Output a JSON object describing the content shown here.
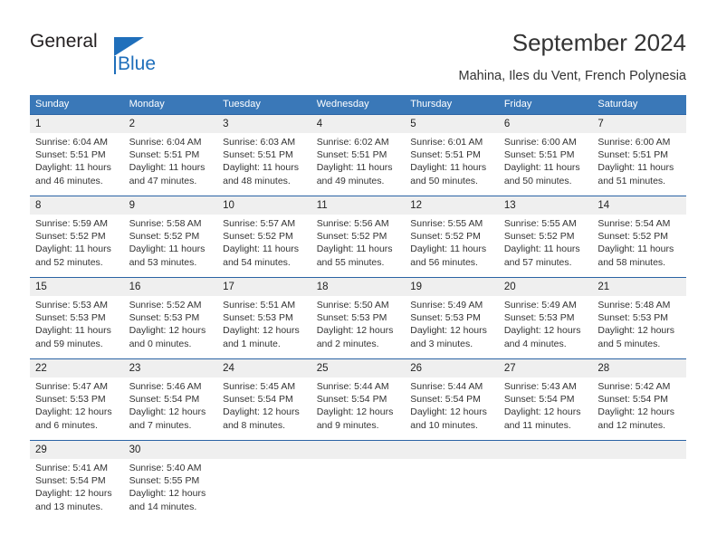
{
  "brand": {
    "name_part1": "General",
    "name_part2": "Blue",
    "accent_color": "#1f6fbb",
    "triangle_icon": "triangle-icon"
  },
  "header": {
    "title": "September 2024",
    "subtitle": "Mahina, Iles du Vent, French Polynesia"
  },
  "calendar": {
    "header_bg": "#3a78b8",
    "daynum_bg": "#efefef",
    "row_divider_color": "#2a63a4",
    "weekdays": [
      "Sunday",
      "Monday",
      "Tuesday",
      "Wednesday",
      "Thursday",
      "Friday",
      "Saturday"
    ],
    "weeks": [
      [
        {
          "day": "1",
          "sunrise": "Sunrise: 6:04 AM",
          "sunset": "Sunset: 5:51 PM",
          "daylight_line1": "Daylight: 11 hours",
          "daylight_line2": "and 46 minutes."
        },
        {
          "day": "2",
          "sunrise": "Sunrise: 6:04 AM",
          "sunset": "Sunset: 5:51 PM",
          "daylight_line1": "Daylight: 11 hours",
          "daylight_line2": "and 47 minutes."
        },
        {
          "day": "3",
          "sunrise": "Sunrise: 6:03 AM",
          "sunset": "Sunset: 5:51 PM",
          "daylight_line1": "Daylight: 11 hours",
          "daylight_line2": "and 48 minutes."
        },
        {
          "day": "4",
          "sunrise": "Sunrise: 6:02 AM",
          "sunset": "Sunset: 5:51 PM",
          "daylight_line1": "Daylight: 11 hours",
          "daylight_line2": "and 49 minutes."
        },
        {
          "day": "5",
          "sunrise": "Sunrise: 6:01 AM",
          "sunset": "Sunset: 5:51 PM",
          "daylight_line1": "Daylight: 11 hours",
          "daylight_line2": "and 50 minutes."
        },
        {
          "day": "6",
          "sunrise": "Sunrise: 6:00 AM",
          "sunset": "Sunset: 5:51 PM",
          "daylight_line1": "Daylight: 11 hours",
          "daylight_line2": "and 50 minutes."
        },
        {
          "day": "7",
          "sunrise": "Sunrise: 6:00 AM",
          "sunset": "Sunset: 5:51 PM",
          "daylight_line1": "Daylight: 11 hours",
          "daylight_line2": "and 51 minutes."
        }
      ],
      [
        {
          "day": "8",
          "sunrise": "Sunrise: 5:59 AM",
          "sunset": "Sunset: 5:52 PM",
          "daylight_line1": "Daylight: 11 hours",
          "daylight_line2": "and 52 minutes."
        },
        {
          "day": "9",
          "sunrise": "Sunrise: 5:58 AM",
          "sunset": "Sunset: 5:52 PM",
          "daylight_line1": "Daylight: 11 hours",
          "daylight_line2": "and 53 minutes."
        },
        {
          "day": "10",
          "sunrise": "Sunrise: 5:57 AM",
          "sunset": "Sunset: 5:52 PM",
          "daylight_line1": "Daylight: 11 hours",
          "daylight_line2": "and 54 minutes."
        },
        {
          "day": "11",
          "sunrise": "Sunrise: 5:56 AM",
          "sunset": "Sunset: 5:52 PM",
          "daylight_line1": "Daylight: 11 hours",
          "daylight_line2": "and 55 minutes."
        },
        {
          "day": "12",
          "sunrise": "Sunrise: 5:55 AM",
          "sunset": "Sunset: 5:52 PM",
          "daylight_line1": "Daylight: 11 hours",
          "daylight_line2": "and 56 minutes."
        },
        {
          "day": "13",
          "sunrise": "Sunrise: 5:55 AM",
          "sunset": "Sunset: 5:52 PM",
          "daylight_line1": "Daylight: 11 hours",
          "daylight_line2": "and 57 minutes."
        },
        {
          "day": "14",
          "sunrise": "Sunrise: 5:54 AM",
          "sunset": "Sunset: 5:52 PM",
          "daylight_line1": "Daylight: 11 hours",
          "daylight_line2": "and 58 minutes."
        }
      ],
      [
        {
          "day": "15",
          "sunrise": "Sunrise: 5:53 AM",
          "sunset": "Sunset: 5:53 PM",
          "daylight_line1": "Daylight: 11 hours",
          "daylight_line2": "and 59 minutes."
        },
        {
          "day": "16",
          "sunrise": "Sunrise: 5:52 AM",
          "sunset": "Sunset: 5:53 PM",
          "daylight_line1": "Daylight: 12 hours",
          "daylight_line2": "and 0 minutes."
        },
        {
          "day": "17",
          "sunrise": "Sunrise: 5:51 AM",
          "sunset": "Sunset: 5:53 PM",
          "daylight_line1": "Daylight: 12 hours",
          "daylight_line2": "and 1 minute."
        },
        {
          "day": "18",
          "sunrise": "Sunrise: 5:50 AM",
          "sunset": "Sunset: 5:53 PM",
          "daylight_line1": "Daylight: 12 hours",
          "daylight_line2": "and 2 minutes."
        },
        {
          "day": "19",
          "sunrise": "Sunrise: 5:49 AM",
          "sunset": "Sunset: 5:53 PM",
          "daylight_line1": "Daylight: 12 hours",
          "daylight_line2": "and 3 minutes."
        },
        {
          "day": "20",
          "sunrise": "Sunrise: 5:49 AM",
          "sunset": "Sunset: 5:53 PM",
          "daylight_line1": "Daylight: 12 hours",
          "daylight_line2": "and 4 minutes."
        },
        {
          "day": "21",
          "sunrise": "Sunrise: 5:48 AM",
          "sunset": "Sunset: 5:53 PM",
          "daylight_line1": "Daylight: 12 hours",
          "daylight_line2": "and 5 minutes."
        }
      ],
      [
        {
          "day": "22",
          "sunrise": "Sunrise: 5:47 AM",
          "sunset": "Sunset: 5:53 PM",
          "daylight_line1": "Daylight: 12 hours",
          "daylight_line2": "and 6 minutes."
        },
        {
          "day": "23",
          "sunrise": "Sunrise: 5:46 AM",
          "sunset": "Sunset: 5:54 PM",
          "daylight_line1": "Daylight: 12 hours",
          "daylight_line2": "and 7 minutes."
        },
        {
          "day": "24",
          "sunrise": "Sunrise: 5:45 AM",
          "sunset": "Sunset: 5:54 PM",
          "daylight_line1": "Daylight: 12 hours",
          "daylight_line2": "and 8 minutes."
        },
        {
          "day": "25",
          "sunrise": "Sunrise: 5:44 AM",
          "sunset": "Sunset: 5:54 PM",
          "daylight_line1": "Daylight: 12 hours",
          "daylight_line2": "and 9 minutes."
        },
        {
          "day": "26",
          "sunrise": "Sunrise: 5:44 AM",
          "sunset": "Sunset: 5:54 PM",
          "daylight_line1": "Daylight: 12 hours",
          "daylight_line2": "and 10 minutes."
        },
        {
          "day": "27",
          "sunrise": "Sunrise: 5:43 AM",
          "sunset": "Sunset: 5:54 PM",
          "daylight_line1": "Daylight: 12 hours",
          "daylight_line2": "and 11 minutes."
        },
        {
          "day": "28",
          "sunrise": "Sunrise: 5:42 AM",
          "sunset": "Sunset: 5:54 PM",
          "daylight_line1": "Daylight: 12 hours",
          "daylight_line2": "and 12 minutes."
        }
      ],
      [
        {
          "day": "29",
          "sunrise": "Sunrise: 5:41 AM",
          "sunset": "Sunset: 5:54 PM",
          "daylight_line1": "Daylight: 12 hours",
          "daylight_line2": "and 13 minutes."
        },
        {
          "day": "30",
          "sunrise": "Sunrise: 5:40 AM",
          "sunset": "Sunset: 5:55 PM",
          "daylight_line1": "Daylight: 12 hours",
          "daylight_line2": "and 14 minutes."
        },
        {
          "day": "",
          "sunrise": "",
          "sunset": "",
          "daylight_line1": "",
          "daylight_line2": ""
        },
        {
          "day": "",
          "sunrise": "",
          "sunset": "",
          "daylight_line1": "",
          "daylight_line2": ""
        },
        {
          "day": "",
          "sunrise": "",
          "sunset": "",
          "daylight_line1": "",
          "daylight_line2": ""
        },
        {
          "day": "",
          "sunrise": "",
          "sunset": "",
          "daylight_line1": "",
          "daylight_line2": ""
        },
        {
          "day": "",
          "sunrise": "",
          "sunset": "",
          "daylight_line1": "",
          "daylight_line2": ""
        }
      ]
    ]
  }
}
